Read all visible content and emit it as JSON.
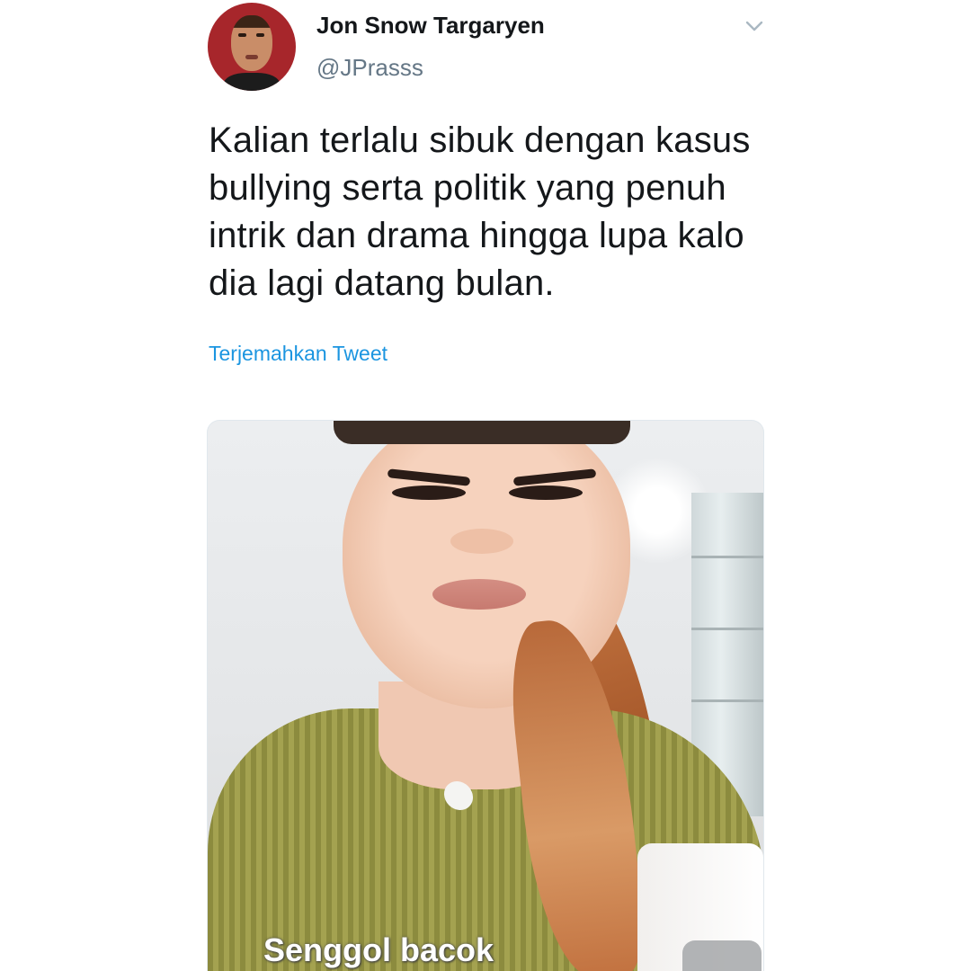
{
  "tweet": {
    "display_name": "Jon Snow Targaryen",
    "handle": "@JPrasss",
    "text_lines": [
      "Kalian terlalu sibuk dengan kasus",
      "bullying serta politik yang penuh",
      "intrik dan drama hingga lupa kalo",
      "dia lagi datang bulan."
    ],
    "translate_label": "Terjemahkan Tweet",
    "menu_icon": "chevron-down-icon",
    "media": {
      "caption": "Senggol bacok"
    }
  },
  "colors": {
    "link": "#1b95e0",
    "handle": "#657786",
    "text": "#14171a"
  }
}
